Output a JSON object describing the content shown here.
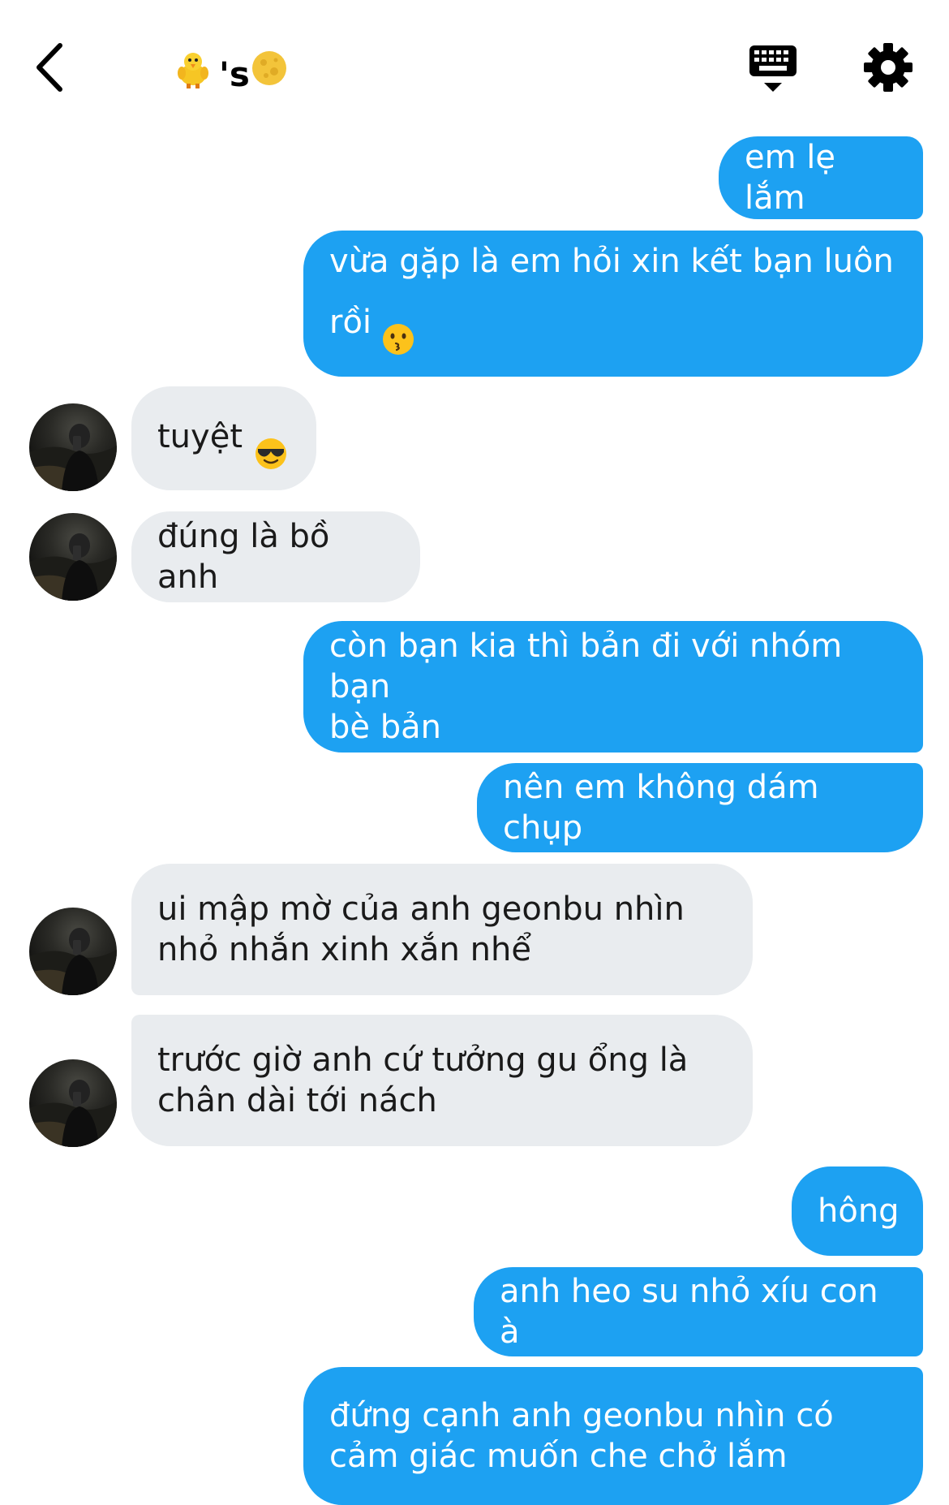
{
  "header": {
    "title_suffix": "'s",
    "title_lead_emoji": "baby-chick-icon",
    "title_trail_emoji": "full-moon-icon",
    "back_icon": "chevron-left-icon",
    "keyboard_icon": "keyboard-hide-icon",
    "settings_icon": "gear-icon"
  },
  "colors": {
    "outgoing_bubble": "#1da1f2",
    "incoming_bubble": "#e9ecef"
  },
  "messages": [
    {
      "dir": "out",
      "text": "em lẹ lắm"
    },
    {
      "dir": "out",
      "text": "vừa gặp là em hỏi xin kết bạn luôn\nrồi",
      "emoji": "kissing-face-icon"
    },
    {
      "dir": "in",
      "text": "tuyệt",
      "emoji": "sunglasses-face-icon"
    },
    {
      "dir": "in",
      "text": "đúng là bồ anh"
    },
    {
      "dir": "out",
      "text": "còn bạn kia thì bản đi với nhóm bạn\nbè bản"
    },
    {
      "dir": "out",
      "text": "nên em không dám chụp"
    },
    {
      "dir": "in",
      "text": "ui mập mờ của anh geonbu nhìn\nnhỏ nhắn xinh xắn nhể"
    },
    {
      "dir": "in",
      "text": "trước giờ anh cứ tưởng gu ổng là\nchân dài tới nách"
    },
    {
      "dir": "out",
      "text": "hông"
    },
    {
      "dir": "out",
      "text": "anh heo su nhỏ xíu con à"
    },
    {
      "dir": "out",
      "text": "đứng cạnh anh geonbu nhìn có\ncảm giác muốn che chở lắm"
    }
  ]
}
